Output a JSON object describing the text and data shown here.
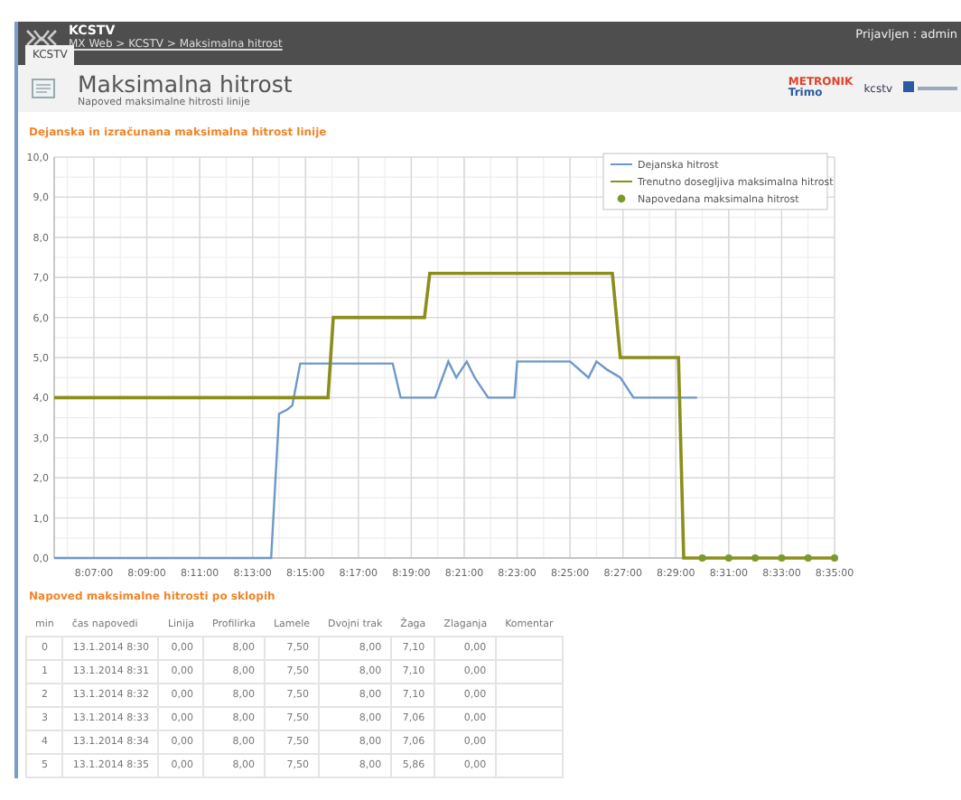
{
  "header": {
    "app": "KCSTV",
    "breadcrumb": "MX Web > KCSTV > Maksimalna hitrost",
    "user": "Prijavljen : admin",
    "tabs": [
      {
        "label": "KCSTV",
        "selected": true
      }
    ]
  },
  "page": {
    "title": "Maksimalna hitrost",
    "subtitle": "Napoved maksimalne hitrosti linije",
    "logos": [
      "METRONIK",
      "Trimo",
      "kcstv"
    ]
  },
  "chart": {
    "title": "Dejanska in izračunana maksimalna hitrost linije",
    "chart_data": {
      "type": "line",
      "grid": true,
      "legend": true,
      "xlim": [
        29130,
        30900
      ],
      "ylim": [
        0,
        10
      ],
      "xticks": [
        {
          "value": 29220,
          "label": "8:07:00"
        },
        {
          "value": 29340,
          "label": "8:09:00"
        },
        {
          "value": 29460,
          "label": "8:11:00"
        },
        {
          "value": 29580,
          "label": "8:13:00"
        },
        {
          "value": 29700,
          "label": "8:15:00"
        },
        {
          "value": 29820,
          "label": "8:17:00"
        },
        {
          "value": 29940,
          "label": "8:19:00"
        },
        {
          "value": 30060,
          "label": "8:21:00"
        },
        {
          "value": 30180,
          "label": "8:23:00"
        },
        {
          "value": 30300,
          "label": "8:25:00"
        },
        {
          "value": 30420,
          "label": "8:27:00"
        },
        {
          "value": 30540,
          "label": "8:29:00"
        },
        {
          "value": 30660,
          "label": "8:31:00"
        },
        {
          "value": 30780,
          "label": "8:33:00"
        },
        {
          "value": 30900,
          "label": "8:35:00"
        }
      ],
      "yticks": [
        {
          "value": 0,
          "label": "0,0"
        },
        {
          "value": 1,
          "label": "1,0"
        },
        {
          "value": 2,
          "label": "2,0"
        },
        {
          "value": 3,
          "label": "3,0"
        },
        {
          "value": 4,
          "label": "4,0"
        },
        {
          "value": 5,
          "label": "5,0"
        },
        {
          "value": 6,
          "label": "6,0"
        },
        {
          "value": 7,
          "label": "7,0"
        },
        {
          "value": 8,
          "label": "8,0"
        },
        {
          "value": 9,
          "label": "9,0"
        },
        {
          "value": 10,
          "label": "10,0"
        }
      ],
      "series": [
        {
          "name": "Dejanska hitrost",
          "color": "#6d98c9",
          "type": "line",
          "x": [
            29130,
            29622,
            29640,
            29658,
            29670,
            29688,
            29898,
            29916,
            29994,
            30024,
            30042,
            30066,
            30084,
            30114,
            30174,
            30180,
            30300,
            30342,
            30360,
            30384,
            30414,
            30444,
            30588
          ],
          "values": [
            0,
            0,
            3.6,
            3.7,
            3.8,
            4.85,
            4.85,
            4.0,
            4.0,
            4.9,
            4.5,
            4.9,
            4.5,
            4.0,
            4.0,
            4.9,
            4.9,
            4.5,
            4.9,
            4.7,
            4.5,
            4.0,
            4.0
          ]
        },
        {
          "name": "Trenutno dosegljiva maksimalna hitrost",
          "color": "#8a8f1a",
          "type": "line",
          "x": [
            29130,
            29751,
            29763,
            29970,
            29982,
            30396,
            30414,
            30546,
            30558,
            30900
          ],
          "values": [
            4,
            4,
            6,
            6,
            7.1,
            7.1,
            5,
            5,
            0,
            0
          ]
        },
        {
          "name": "Napovedana maksimalna hitrost",
          "color": "#7a9a2a",
          "type": "scatter",
          "x": [
            30600,
            30660,
            30720,
            30780,
            30840,
            30900
          ],
          "values": [
            0,
            0,
            0,
            0,
            0,
            0
          ]
        }
      ]
    }
  },
  "table": {
    "title": "Napoved maksimalne hitrosti po sklopih",
    "columns": [
      "min",
      "čas napovedi",
      "Linija",
      "Profilirka",
      "Lamele",
      "Dvojni trak",
      "Žaga",
      "Zlaganja",
      "Komentar"
    ],
    "rows": [
      [
        "0",
        "13.1.2014 8:30",
        "0,00",
        "8,00",
        "7,50",
        "8,00",
        "7,10",
        "0,00"
      ],
      [
        "1",
        "13.1.2014 8:31",
        "0,00",
        "8,00",
        "7,50",
        "8,00",
        "7,10",
        "0,00"
      ],
      [
        "2",
        "13.1.2014 8:32",
        "0,00",
        "8,00",
        "7,50",
        "8,00",
        "7,10",
        "0,00"
      ],
      [
        "3",
        "13.1.2014 8:33",
        "0,00",
        "8,00",
        "7,50",
        "8,00",
        "7,06",
        "0,00"
      ],
      [
        "4",
        "13.1.2014 8:34",
        "0,00",
        "8,00",
        "7,50",
        "8,00",
        "7,06",
        "0,00"
      ],
      [
        "5",
        "13.1.2014 8:35",
        "0,00",
        "8,00",
        "7,50",
        "8,00",
        "5,86",
        "0,00"
      ]
    ]
  }
}
